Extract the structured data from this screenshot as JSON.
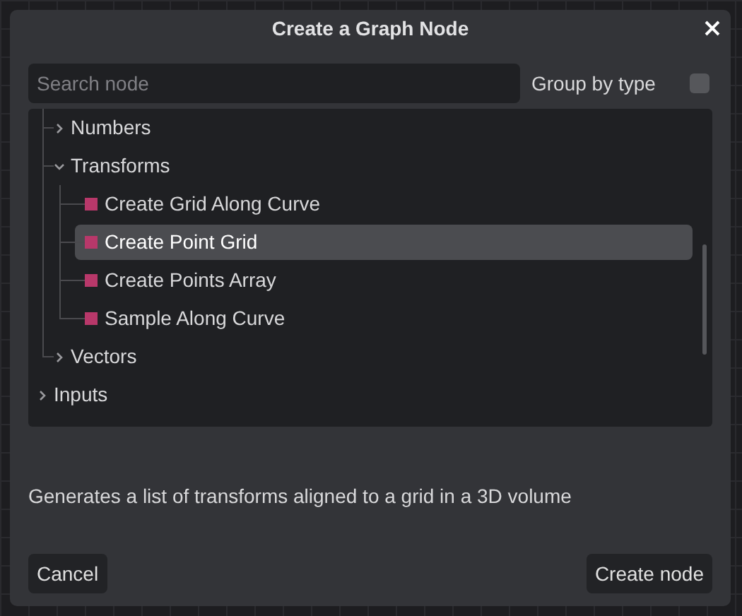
{
  "dialog": {
    "title": "Create a Graph Node"
  },
  "search": {
    "placeholder": "Search node"
  },
  "group_by_type": {
    "label": "Group by type",
    "checked": false
  },
  "tree": [
    {
      "children": [
        {
          "label": "Numbers",
          "expanded": false
        },
        {
          "label": "Transforms",
          "expanded": true,
          "children": [
            {
              "label": "Create Grid Along Curve",
              "selected": false,
              "color": "#b8386a"
            },
            {
              "label": "Create Point Grid",
              "selected": true,
              "color": "#b8386a"
            },
            {
              "label": "Create Points Array",
              "selected": false,
              "color": "#b8386a"
            },
            {
              "label": "Sample Along Curve",
              "selected": false,
              "color": "#b8386a"
            }
          ]
        },
        {
          "label": "Vectors",
          "expanded": false
        }
      ]
    },
    {
      "label": "Inputs",
      "expanded": false
    }
  ],
  "description": "Generates a list of transforms aligned to a grid in a 3D volume",
  "buttons": {
    "cancel": "Cancel",
    "create": "Create node"
  }
}
